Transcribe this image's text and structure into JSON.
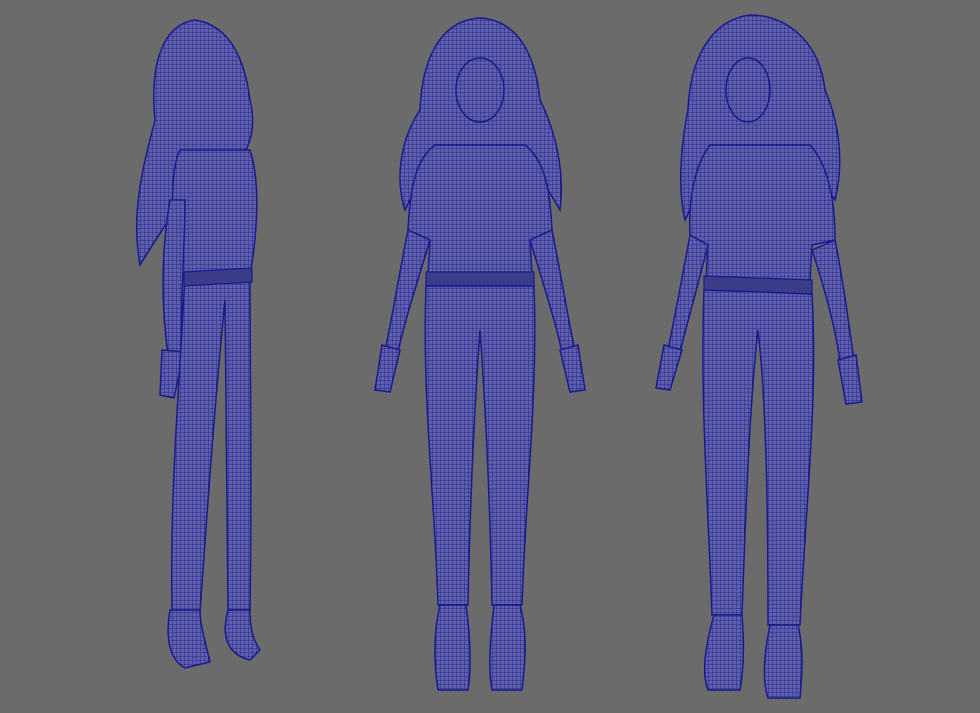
{
  "viewport": {
    "background_color": "#6b6b6b",
    "wire_color": "#1a1a8c",
    "fill_color": "#5d5fa8",
    "shading": "wireframe-on-shaded"
  },
  "figures": [
    {
      "view": "side"
    },
    {
      "view": "front"
    },
    {
      "view": "three-quarter"
    }
  ]
}
